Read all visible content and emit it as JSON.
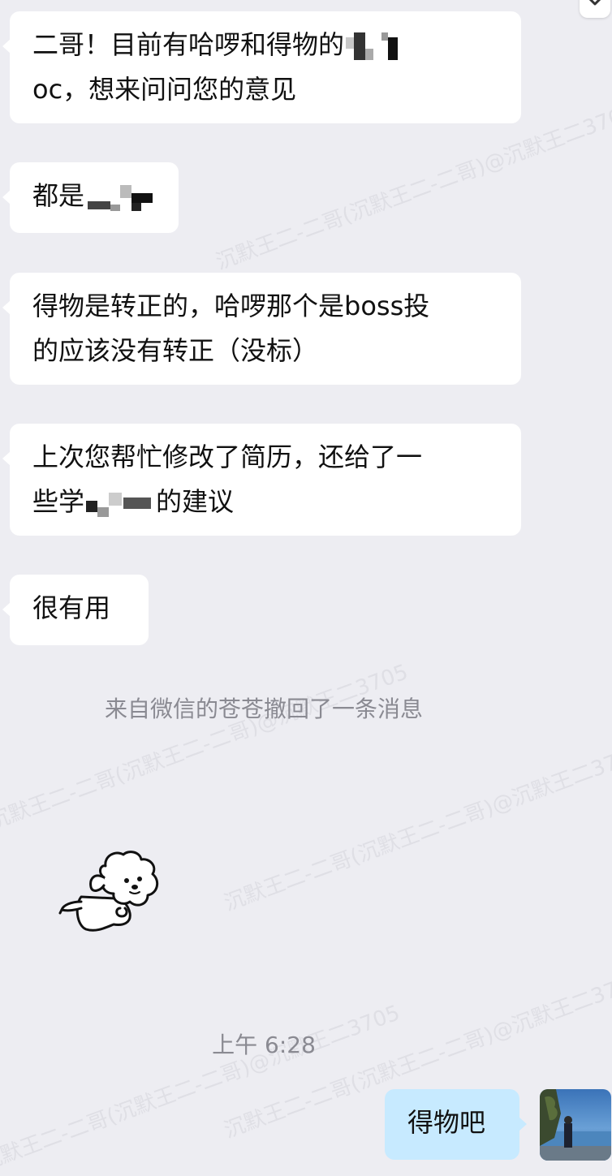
{
  "watermark_text": "沉默王二-二哥(沉默王二-二哥)@沉默王二3705",
  "messages": [
    {
      "id": 1,
      "side": "left",
      "line1_prefix": "二哥！目前有哈啰和得物的",
      "line2": "oc，想来问问您的意见"
    },
    {
      "id": 2,
      "side": "left",
      "prefix": "都是"
    },
    {
      "id": 3,
      "side": "left",
      "line1": "得物是转正的，哈啰那个是boss投",
      "line2": "的应该没有转正（没标）"
    },
    {
      "id": 4,
      "side": "left",
      "line1": "上次您帮忙修改了简历，还给了一",
      "line2_prefix": "些学",
      "line2_suffix": "的建议"
    },
    {
      "id": 5,
      "side": "left",
      "text": "很有用"
    }
  ],
  "system_notice": "来自微信的苍苍撤回了一条消息",
  "sticker_name": "white puppy sticker",
  "timestamp": "上午 6:28",
  "reply": {
    "side": "right",
    "text": "得物吧"
  },
  "colors": {
    "background": "#ededf2",
    "bubble_left": "#ffffff",
    "bubble_right": "#c7eaff",
    "system_text": "#8a8a92"
  }
}
